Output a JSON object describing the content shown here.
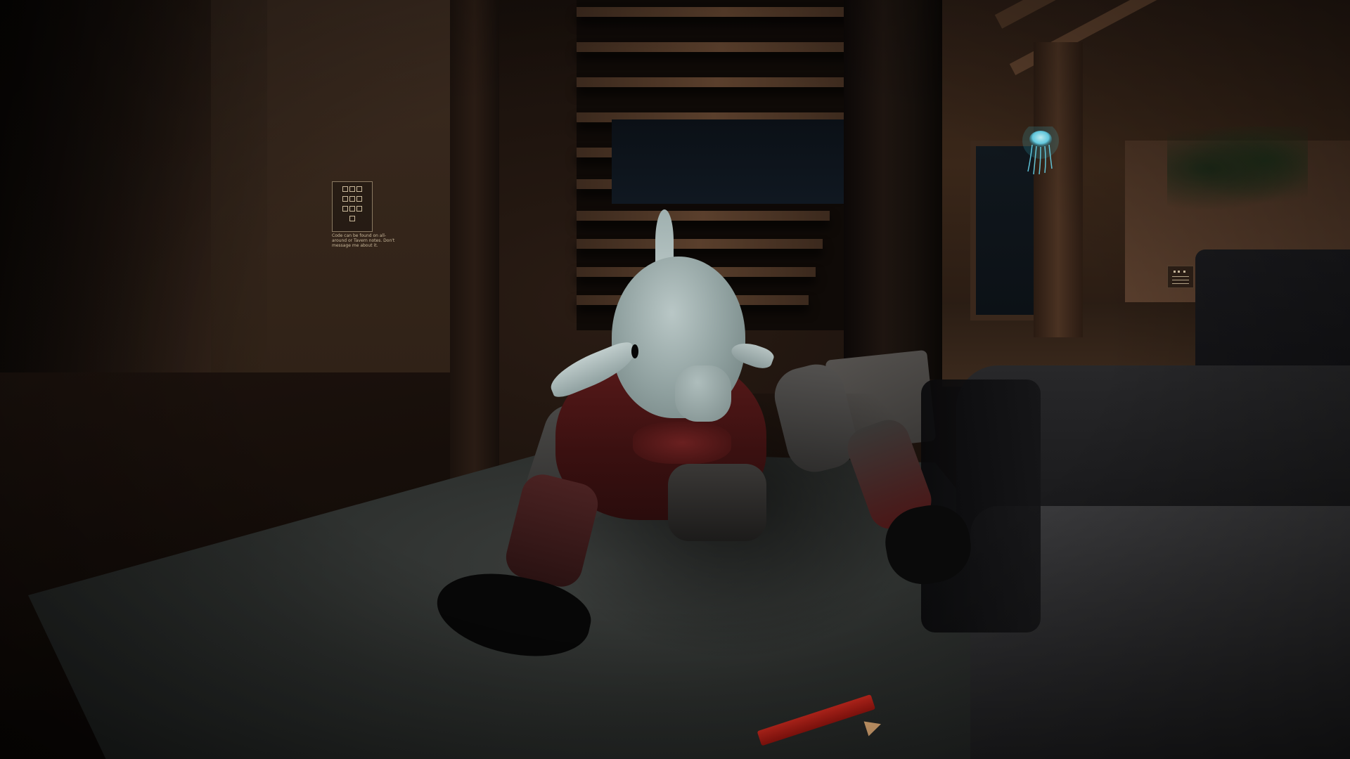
{
  "scene": {
    "type": "3d-vr-world",
    "lighting": "dark-interior"
  },
  "keypad_sign": {
    "keys": [
      "7",
      "8",
      "9",
      "4",
      "5",
      "6",
      "1",
      "2",
      "3",
      "0"
    ],
    "note": "Code can be found on all-around or Tavern notes. Don't message me about it."
  },
  "colors": {
    "dolphin": "#a7b7b6",
    "armor_red": "#5a1a1a",
    "jellyfish": "#6fe6ff",
    "pencil": "#c52218",
    "rug": "#2e3130",
    "sofa": "#2a2a2c"
  },
  "icons": {
    "jellyfish": "jellyfish-icon"
  }
}
